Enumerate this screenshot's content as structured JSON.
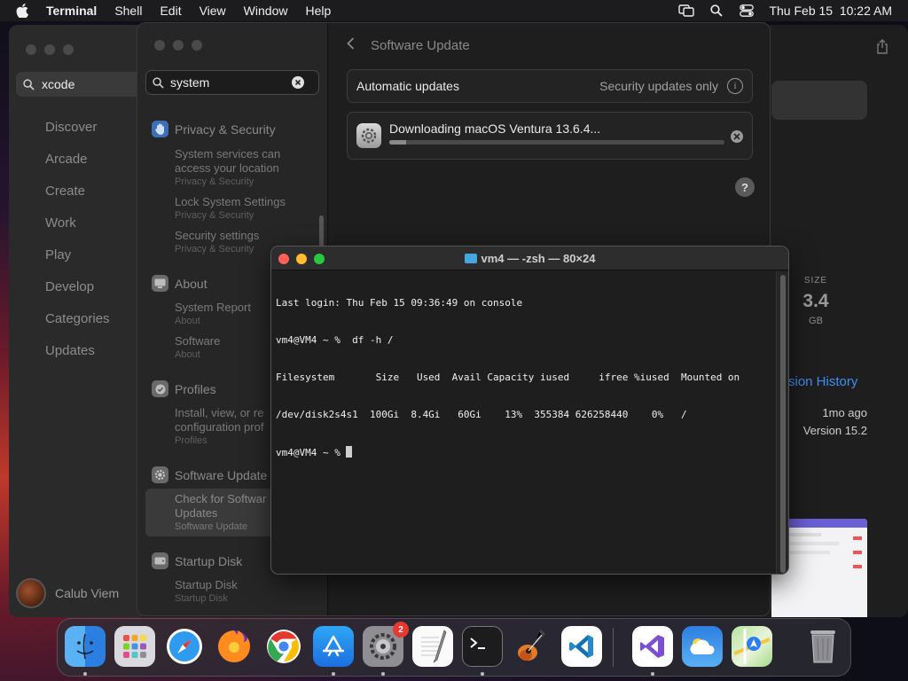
{
  "menubar": {
    "app_name": "Terminal",
    "items": [
      "Shell",
      "Edit",
      "View",
      "Window",
      "Help"
    ],
    "datetime": "Thu Feb 15  10:22 AM"
  },
  "appstore": {
    "search_value": "xcode",
    "nav": [
      "Discover",
      "Arcade",
      "Create",
      "Work",
      "Play",
      "Develop",
      "Categories",
      "Updates"
    ],
    "user_name": "Calub Viem",
    "size_label": "SIZE",
    "size_value": "3.4",
    "size_unit": "GB",
    "version_history": "rsion History",
    "updated_ago": "1mo ago",
    "version": "Version 15.2"
  },
  "settings": {
    "search_value": "system",
    "title": "Software Update",
    "auto_updates_label": "Automatic updates",
    "auto_updates_value": "Security updates only",
    "download_text": "Downloading macOS Ventura 13.6.4...",
    "download_progress": 0.05,
    "help": "?",
    "sections": [
      {
        "name": "Privacy & Security",
        "results": [
          {
            "title": "System services can access your location",
            "title2": "access your location",
            "sub": "Privacy & Security"
          },
          {
            "title": "Lock System Settings",
            "sub": "Privacy & Security"
          },
          {
            "title": "Security settings",
            "sub": "Privacy & Security"
          }
        ]
      },
      {
        "name": "About",
        "results": [
          {
            "title": "System Report",
            "sub": "About"
          },
          {
            "title": "Software",
            "sub": "About"
          }
        ]
      },
      {
        "name": "Profiles",
        "results": [
          {
            "title": "Install, view, or re",
            "title2": "configuration prof",
            "sub": "Profiles"
          }
        ]
      },
      {
        "name": "Software Update",
        "results": [
          {
            "title": "Check for Softwar",
            "title2": "Updates",
            "sub": "Software Update"
          }
        ]
      },
      {
        "name": "Startup Disk",
        "results": [
          {
            "title": "Startup Disk",
            "sub": "Startup Disk"
          }
        ]
      }
    ]
  },
  "terminal": {
    "title": "vm4 — -zsh — 80×24",
    "lines": [
      "Last login: Thu Feb 15 09:36:49 on console",
      "vm4@VM4 ~ %  df -h /",
      "Filesystem       Size   Used  Avail Capacity iused     ifree %iused  Mounted on",
      "/dev/disk2s4s1  100Gi  8.4Gi   60Gi    13%  355384 626258440    0%   /"
    ],
    "prompt": "vm4@VM4 ~ % "
  },
  "dock": {
    "items": [
      "Finder",
      "Launchpad",
      "Safari",
      "Firefox",
      "Chrome",
      "App Store",
      "System Settings",
      "TextEdit",
      "Terminal",
      "GarageBand",
      "Visual Studio Code",
      "Visual Studio",
      "Weather",
      "Maps",
      "Trash"
    ],
    "settings_badge": "2"
  }
}
